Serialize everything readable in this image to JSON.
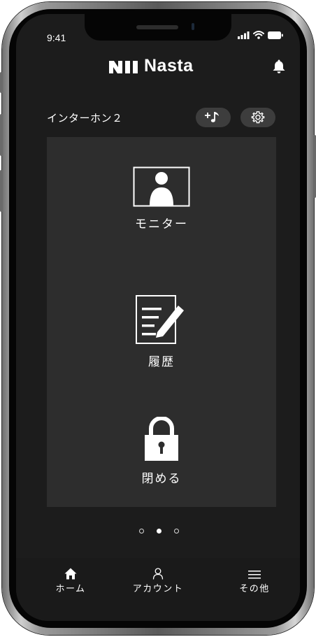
{
  "status_bar": {
    "time": "9:41"
  },
  "header": {
    "brand": "Nasta",
    "bell_icon": "bell-icon"
  },
  "device": {
    "title": "インターホン２",
    "add_sound_icon": "plus-music-note-icon",
    "settings_icon": "gear-icon"
  },
  "actions": [
    {
      "label": "モニター",
      "icon": "monitor-person-icon"
    },
    {
      "label": "履歴",
      "icon": "history-document-pencil-icon"
    },
    {
      "label": "閉める",
      "icon": "padlock-icon"
    }
  ],
  "pagination": {
    "total": 3,
    "active_index": 1
  },
  "tabbar": {
    "items": [
      {
        "label": "ホーム",
        "icon": "home-icon"
      },
      {
        "label": "アカウント",
        "icon": "person-icon"
      },
      {
        "label": "その他",
        "icon": "menu-icon"
      }
    ]
  },
  "colors": {
    "screen_background": "#1c1c1c",
    "panel_background": "#2d2d2d",
    "pill_background": "#3d3d3d",
    "foreground": "#ffffff"
  }
}
